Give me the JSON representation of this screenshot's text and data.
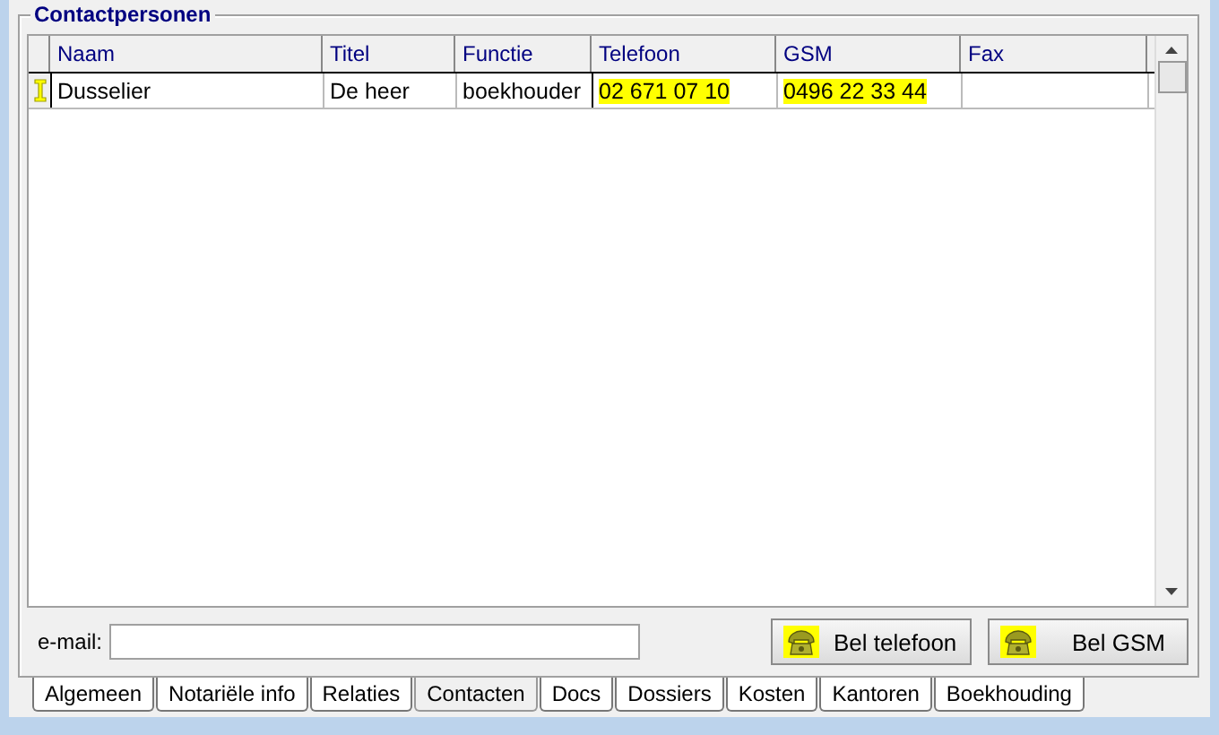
{
  "group_title": "Contactpersonen",
  "table": {
    "columns": [
      "Naam",
      "Titel",
      "Functie",
      "Telefoon",
      "GSM",
      "Fax"
    ],
    "rows": [
      {
        "selected": true,
        "cells": [
          {
            "text": "Dusselier",
            "highlighted": false,
            "editing": false
          },
          {
            "text": "De heer",
            "highlighted": false,
            "editing": false
          },
          {
            "text": "boekhouder",
            "highlighted": false,
            "editing": true
          },
          {
            "text": "02 671 07 10",
            "highlighted": true,
            "editing": false
          },
          {
            "text": "0496 22 33 44",
            "highlighted": true,
            "editing": false
          },
          {
            "highlighted": false,
            "editing": false
          }
        ]
      }
    ]
  },
  "email": {
    "label": "e-mail:"
  },
  "buttons": [
    {
      "label": "Bel telefoon"
    },
    {
      "label": "Bel GSM"
    }
  ],
  "tabs": [
    {
      "label": "Algemeen",
      "selected": false
    },
    {
      "label": "Notariële info",
      "selected": false
    },
    {
      "label": "Relaties",
      "selected": false
    },
    {
      "label": "Contacten",
      "selected": true
    },
    {
      "label": "Docs",
      "selected": false
    },
    {
      "label": "Dossiers",
      "selected": false
    },
    {
      "label": "Kosten",
      "selected": false
    },
    {
      "label": "Kantoren",
      "selected": false
    },
    {
      "label": "Boekhouding",
      "selected": false
    }
  ]
}
